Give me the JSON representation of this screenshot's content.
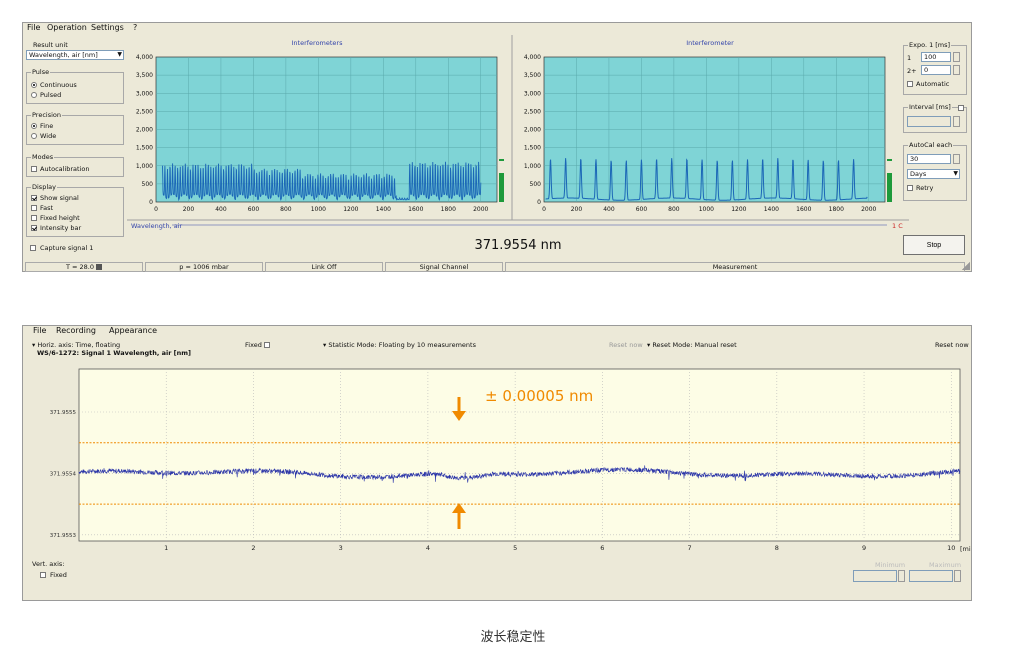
{
  "window1": {
    "menu": [
      "File",
      "Operation",
      "Settings",
      "?"
    ],
    "result_unit_label": "Result unit",
    "result_unit_value": "Wavelength, air  [nm]",
    "pulse": {
      "label": "Pulse",
      "options": [
        "Continuous",
        "Pulsed"
      ],
      "selected": 0
    },
    "precision": {
      "label": "Precision",
      "options": [
        "Fine",
        "Wide"
      ],
      "selected": 0
    },
    "modes": {
      "label": "Modes",
      "autocal": "Autocalibration"
    },
    "display": {
      "label": "Display",
      "items": [
        {
          "label": "Show signal",
          "checked": true
        },
        {
          "label": "Fast",
          "checked": false
        },
        {
          "label": "Fixed height",
          "checked": false
        },
        {
          "label": "Intensity bar",
          "checked": true
        }
      ]
    },
    "capture": "Capture signal 1",
    "chart_left_title": "Interferometers",
    "chart_right_title": "Interferometer",
    "y_ticks": [
      "4,000",
      "3,500",
      "3,000",
      "2,500",
      "2,000",
      "1,500",
      "1,000",
      "500",
      "0"
    ],
    "x_ticks": [
      "0",
      "200",
      "400",
      "600",
      "800",
      "1000",
      "1200",
      "1400",
      "1600",
      "1800",
      "2000"
    ],
    "scale_label": "Wavelength,  air",
    "scale_right": "1  C",
    "reading": "371.9554 nm",
    "expo": {
      "label": "Expo. 1  [ms]",
      "row1_label": "1",
      "row1_value": "100",
      "row2_label": "2+",
      "row2_value": "0",
      "automatic": "Automatic"
    },
    "interval": {
      "label": "Interval [ms]"
    },
    "autocal": {
      "label": "AutoCal each",
      "value": "30",
      "unit": "Days",
      "retry": "Retry"
    },
    "stop": "Stop",
    "status": [
      "T = 28.0",
      "p = 1006 mbar",
      "Link Off",
      "Signal Channel",
      "Measurement"
    ]
  },
  "window2": {
    "menu": [
      "File",
      "Recording",
      "Appearance"
    ],
    "horiz_axis": "▾ Horiz. axis: Time, floating",
    "fixed_top": "Fixed",
    "static_mode": "▾ Statistic Mode: Floating by 10 measurements",
    "reset_now_1": "Reset now",
    "reset_mode": "▾ Reset Mode: Manual reset",
    "reset_now_2": "Reset now",
    "signal_title": "WS/6-1272: Signal 1  Wavelength,  air  [nm]",
    "y_ticks": [
      "371.9555",
      "371.9554",
      "371.9553"
    ],
    "x_ticks": [
      "1",
      "2",
      "3",
      "4",
      "5",
      "6",
      "7",
      "8",
      "9",
      "10"
    ],
    "x_unit": "[min]",
    "annotation": "± 0.00005 nm",
    "vert_axis": "Vert. axis:",
    "fixed_bottom": "Fixed",
    "minimum": "Minimum",
    "maximum": "Maximum"
  },
  "caption": "波长稳定性",
  "chart_data": [
    {
      "type": "line",
      "title": "Interferometers",
      "xlim": [
        0,
        2100
      ],
      "ylim": [
        0,
        4000
      ],
      "description_peaks": "approx. 40 narrow fringes, peak ~900-1000 counts"
    },
    {
      "type": "line",
      "title": "Interferometer",
      "xlim": [
        0,
        2100
      ],
      "ylim": [
        0,
        4000
      ],
      "peaks": 21,
      "peak_height": 1100
    },
    {
      "type": "line",
      "title": "WS/6-1272: Signal 1  Wavelength,  air  [nm]",
      "xlabel": "[min]",
      "xlim": [
        0,
        10.1
      ],
      "ylim": [
        371.95529,
        371.95557
      ],
      "mean": 371.9554,
      "band": [
        371.95535,
        371.95545
      ]
    }
  ],
  "colors": {
    "plot_bg": "#7fd4d6",
    "trace": "#1b67b7",
    "signal": "#2b35a8",
    "band": "#f08a00",
    "yellow_bg": "#fdfde6",
    "frame": "#ece9d8"
  }
}
